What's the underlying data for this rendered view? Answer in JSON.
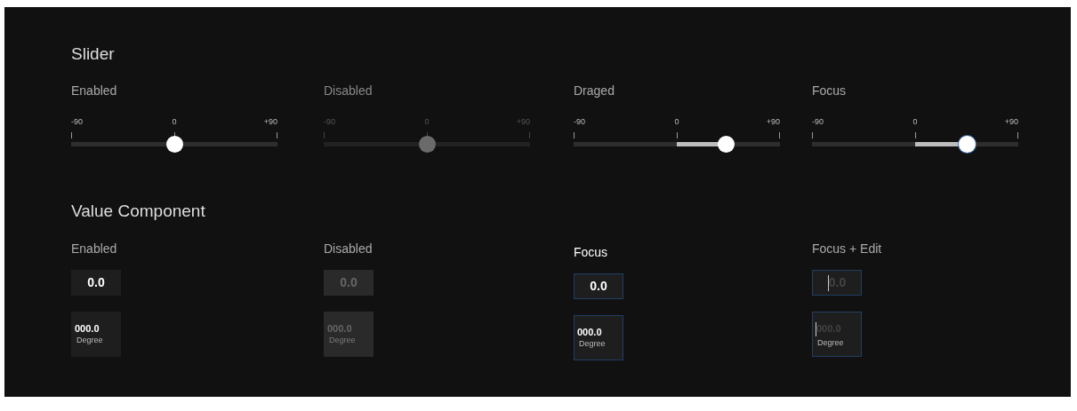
{
  "slider_section": {
    "title": "Slider",
    "sliders": [
      {
        "label": "Enabled",
        "kind": "enabled",
        "ticks": [
          "-90",
          "0",
          "+90"
        ],
        "level": 0.5
      },
      {
        "label": "Disabled",
        "kind": "disabled",
        "ticks": [
          "-90",
          "0",
          "+90"
        ],
        "level": 0.5
      },
      {
        "label": "Draged",
        "kind": "dragged",
        "ticks": [
          "-90",
          "0",
          "+90"
        ],
        "level": 0.74
      },
      {
        "label": "Focus",
        "kind": "focus",
        "ticks": [
          "-90",
          "0",
          "+90"
        ],
        "level": 0.75
      }
    ]
  },
  "value_section": {
    "title": "Value Component",
    "columns": [
      {
        "label": "Enabled",
        "kind": "enabled",
        "value": "0.0",
        "unit_value": "000.0",
        "unit": "Degree"
      },
      {
        "label": "Disabled",
        "kind": "disabled",
        "value": "0.0",
        "unit_value": "000.0",
        "unit": "Degree"
      },
      {
        "label": "Focus",
        "kind": "focus",
        "value": "0.0",
        "unit_value": "000.0",
        "unit": "Degree"
      },
      {
        "label": "Focus + Edit",
        "kind": "focus_edit",
        "value": "0.0",
        "unit_value": "000.0",
        "unit": "Degree"
      }
    ]
  }
}
